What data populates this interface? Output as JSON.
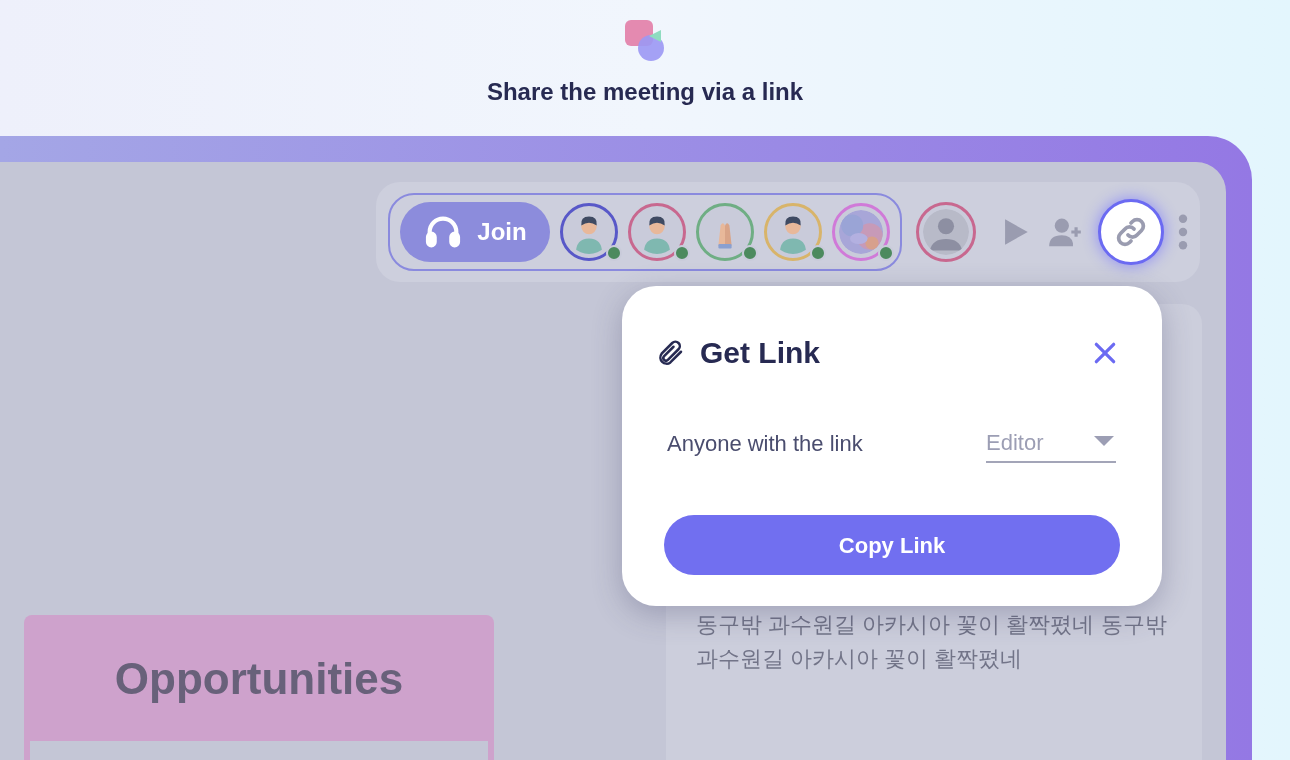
{
  "header": {
    "title": "Share the meeting via a link"
  },
  "toolbar": {
    "join_button": "Join",
    "participants": [
      {
        "kind": "person",
        "color": "#5858c8",
        "online": true
      },
      {
        "kind": "person",
        "color": "#c8688f",
        "online": true
      },
      {
        "kind": "hands",
        "color": "#6fae84",
        "online": true
      },
      {
        "kind": "person",
        "color": "#d8b46a",
        "online": true
      },
      {
        "kind": "picture",
        "color": "#d07ad8",
        "online": true
      }
    ],
    "self": {
      "color": "#c8688f"
    },
    "link_button": {
      "selected": true
    }
  },
  "popup": {
    "title": "Get Link",
    "access_label": "Anyone with the link",
    "role": "Editor",
    "copy_button": "Copy Link"
  },
  "notes": {
    "text": "동구밖 과수원길 아카시아 꽃이 활짝폈네 동구밖 과수원길 아카시아 꽃이 활짝폈네"
  },
  "card": {
    "title": "Opportunities"
  }
}
